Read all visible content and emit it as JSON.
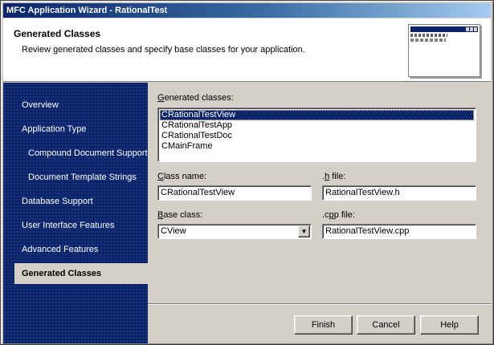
{
  "window": {
    "title": "MFC Application Wizard - RationalTest"
  },
  "header": {
    "title": "Generated Classes",
    "description": "Review generated classes and specify base classes for your application."
  },
  "sidebar": {
    "items": [
      {
        "label": "Overview"
      },
      {
        "label": "Application Type"
      },
      {
        "label": "Compound Document Support"
      },
      {
        "label": "Document Template Strings"
      },
      {
        "label": "Database Support"
      },
      {
        "label": "User Interface Features"
      },
      {
        "label": "Advanced Features"
      },
      {
        "label": "Generated Classes",
        "active": true
      }
    ]
  },
  "form": {
    "generated_classes_label_key": "G",
    "generated_classes_label_rest": "enerated classes:",
    "classes": [
      "CRationalTestView",
      "CRationalTestApp",
      "CRationalTestDoc",
      "CMainFrame"
    ],
    "selected_class": "CRationalTestView",
    "class_name_label_key": "C",
    "class_name_label_rest": "lass name:",
    "class_name_value": "CRationalTestView",
    "h_file_label_pre": ".",
    "h_file_label_key": "h",
    "h_file_label_rest": " file:",
    "h_file_value": "RationalTestView.h",
    "base_class_label_key": "B",
    "base_class_label_rest": "ase class:",
    "base_class_value": "CView",
    "cpp_file_label_pre": ".c",
    "cpp_file_label_key": "p",
    "cpp_file_label_rest": "p file:",
    "cpp_file_value": "RationalTestView.cpp"
  },
  "buttons": {
    "finish": "Finish",
    "cancel": "Cancel",
    "help": "Help"
  }
}
